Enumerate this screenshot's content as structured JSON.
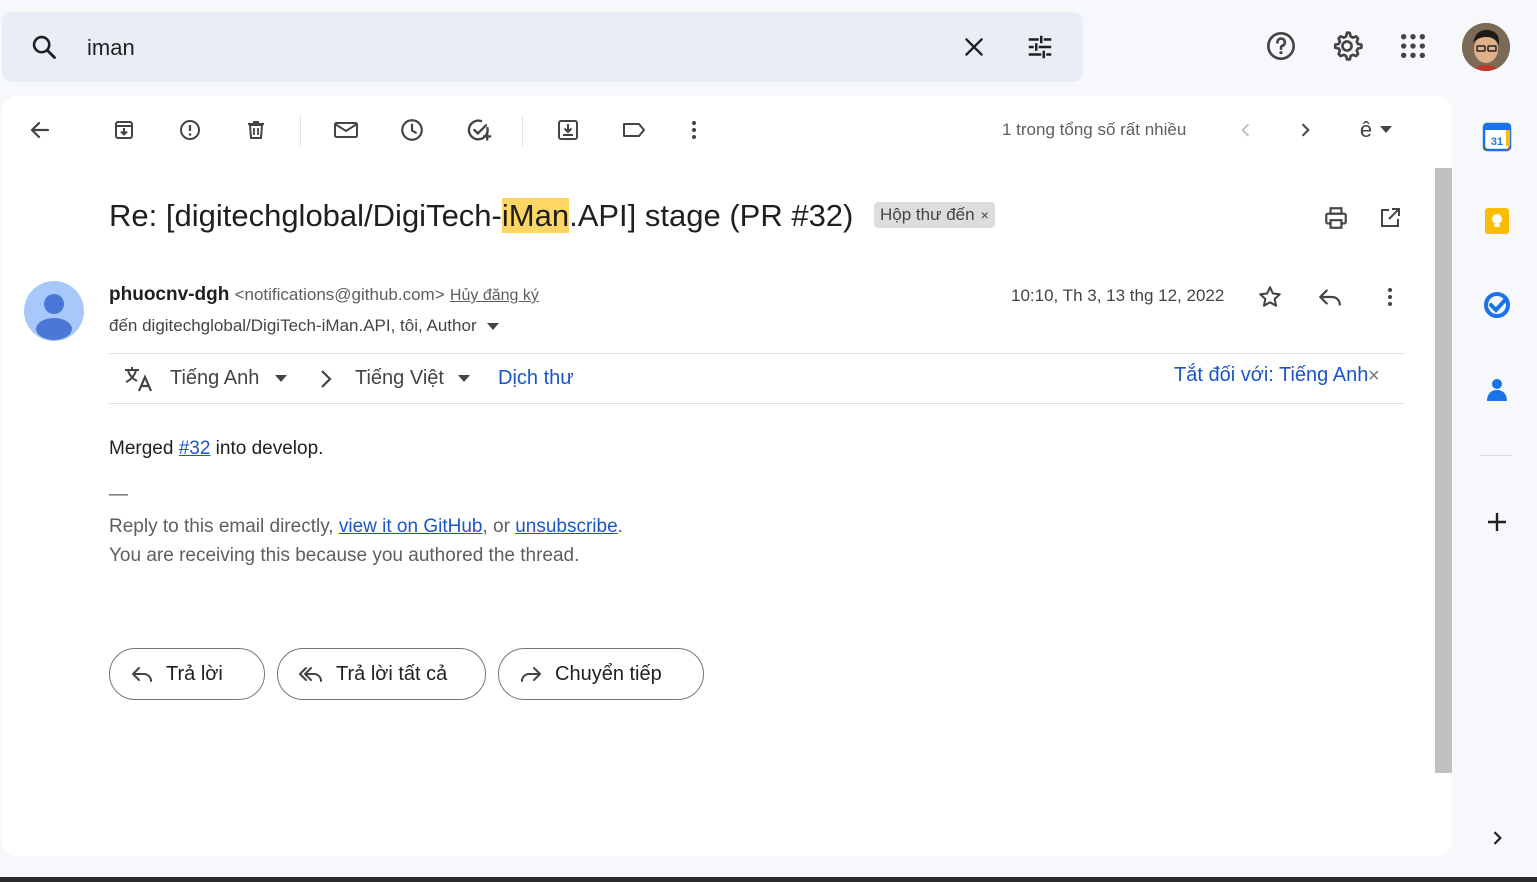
{
  "search": {
    "query": "iman"
  },
  "toolbar": {
    "count_text": "1 trong tổng số rất nhiều",
    "input_tool_label": "ê"
  },
  "email": {
    "subject_prefix": "Re: [digitechglobal/DigiTech-",
    "subject_highlight": "iMan",
    "subject_suffix": ".API] stage (PR #32)",
    "label_chip": "Hộp thư đến",
    "label_chip_close": "×",
    "sender_name": "phuocnv-dgh",
    "sender_email": "<notifications@github.com>",
    "unsubscribe_label": "Hủy đăng ký",
    "to_line": "đến digitechglobal/DigiTech-iMan.API, tôi, Author",
    "date": "10:10, Th 3, 13 thg 12, 2022"
  },
  "translate": {
    "source_lang": "Tiếng Anh",
    "target_lang": "Tiếng Việt",
    "translate_link": "Dịch thư",
    "turn_off_label": "Tắt đối với: Tiếng Anh",
    "close": "×"
  },
  "body": {
    "merged_prefix": "Merged ",
    "merged_link": "#32",
    "merged_suffix": " into develop.",
    "dash": "—",
    "reply_prefix": "Reply to this email directly, ",
    "github_link": "view it on GitHub",
    "reply_mid": ", or ",
    "unsubscribe_link": "unsubscribe",
    "reply_end": ".",
    "receiving_text": "You are receiving this because you authored the thread."
  },
  "actions": {
    "reply": "Trả lời",
    "reply_all": "Trả lời tất cả",
    "forward": "Chuyển tiếp"
  },
  "side_panel": {
    "calendar_day": "31"
  },
  "colors": {
    "accent": "#1a56c6",
    "highlight": "#fdd663",
    "search_bg": "#e9eef6"
  }
}
